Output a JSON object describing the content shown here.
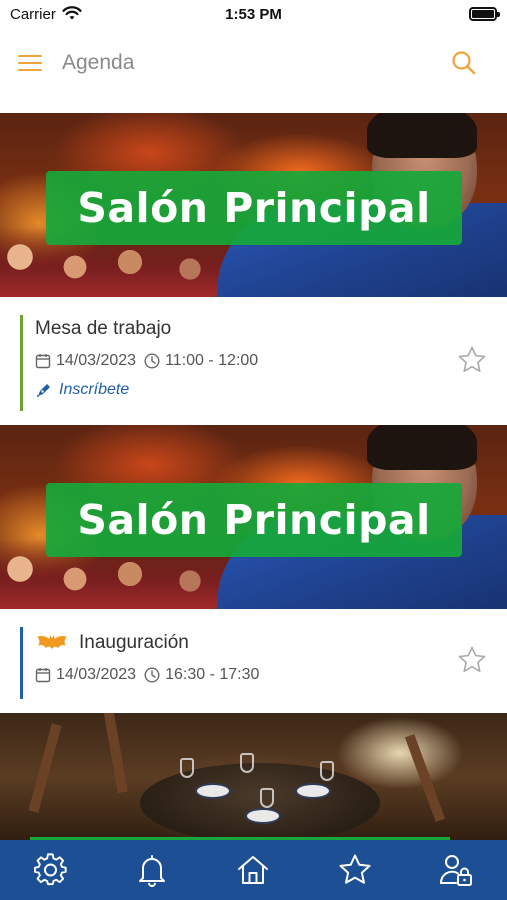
{
  "status_bar": {
    "carrier": "Carrier",
    "time": "1:53 PM"
  },
  "header": {
    "title": "Agenda",
    "menu_icon": "menu-icon",
    "search_icon": "search-icon"
  },
  "colors": {
    "accent": "#f0a33a",
    "nav_bg": "#1c4f94",
    "banner_green": "#16a83a",
    "link_blue": "#1f5fa8",
    "bar_green": "#6fa133",
    "bar_blue": "#1f5fa8",
    "bat_orange": "#f29a1f"
  },
  "sessions": [
    {
      "banner_label": "Salón Principal",
      "title": "Mesa de trabajo",
      "date": "14/03/2023",
      "time": "11:00 - 12:00",
      "signup_label": "Inscríbete",
      "accent": "green"
    },
    {
      "banner_label": "Salón Principal",
      "title": "Inauguración",
      "date": "14/03/2023",
      "time": "16:30 - 17:30",
      "accent": "blue",
      "badge_icon": "bat-icon"
    }
  ],
  "bottom_nav": [
    {
      "icon": "gear-icon"
    },
    {
      "icon": "bell-icon"
    },
    {
      "icon": "home-icon"
    },
    {
      "icon": "star-icon"
    },
    {
      "icon": "user-lock-icon"
    }
  ]
}
